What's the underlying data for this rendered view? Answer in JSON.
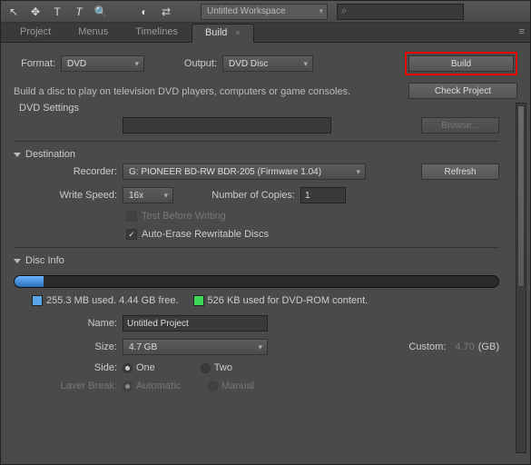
{
  "toolbar": {
    "workspace": "Untitled Workspace"
  },
  "tabs": [
    "Project",
    "Menus",
    "Timelines",
    "Build"
  ],
  "active_tab": "Build",
  "build": {
    "format_label": "Format:",
    "format_value": "DVD",
    "output_label": "Output:",
    "output_value": "DVD Disc",
    "build_btn": "Build",
    "check_btn": "Check Project",
    "desc": "Build a disc to play on television DVD players, computers or game consoles.",
    "settings_title": "DVD Settings",
    "browse_btn": "Browse...",
    "destination": {
      "title": "Destination",
      "recorder_label": "Recorder:",
      "recorder_value": "G: PIONEER BD-RW   BDR-205 (Firmware 1.04)",
      "refresh_btn": "Refresh",
      "write_speed_label": "Write Speed:",
      "write_speed_value": "16x",
      "copies_label": "Number of Copies:",
      "copies_value": "1",
      "test_label": "Test Before Writing",
      "erase_label": "Auto-Erase Rewritable Discs"
    },
    "disc_info": {
      "title": "Disc Info",
      "used_pct": 6,
      "used_label": "255.3 MB used.  4.44 GB free.",
      "rom_label": "526 KB used for DVD-ROM content.",
      "name_label": "Name:",
      "name_value": "Untitled Project",
      "size_label": "Size:",
      "size_value": "4.7 GB",
      "custom_label": "Custom:",
      "custom_value": "4.70",
      "custom_unit": "(GB)",
      "side_label": "Side:",
      "side_one": "One",
      "side_two": "Two",
      "layer_label": "Laver Break:",
      "layer_auto": "Automatic",
      "layer_manual": "Manual"
    },
    "colors": {
      "used": "#5aa6e8",
      "rom": "#3cd858"
    }
  }
}
